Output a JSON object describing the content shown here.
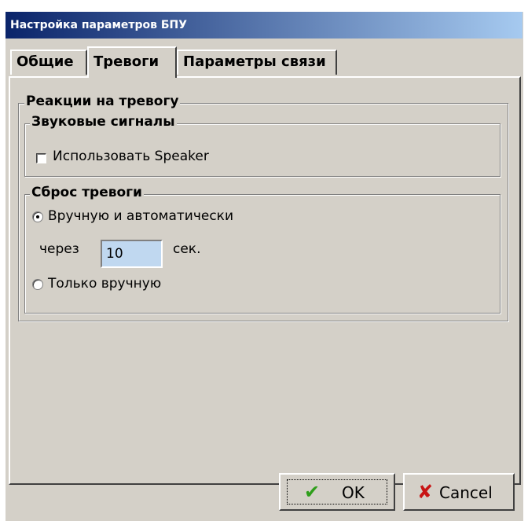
{
  "window": {
    "title": "Настройка параметров БПУ"
  },
  "tabs": [
    {
      "label": "Общие",
      "active": false
    },
    {
      "label": "Тревоги",
      "active": true
    },
    {
      "label": "Параметры связи",
      "active": false
    }
  ],
  "alarm_reactions": {
    "legend": "Реакции на тревогу",
    "sound": {
      "legend": "Звуковые сигналы",
      "use_speaker_label": "Использовать Speaker",
      "use_speaker_checked": false
    },
    "reset": {
      "legend": "Сброс тревоги",
      "manual_auto_label": "Вручную и автоматически",
      "manual_auto_selected": true,
      "after_label": "через",
      "seconds_value": "10",
      "seconds_unit": "сек.",
      "manual_only_label": "Только вручную",
      "manual_only_selected": false
    }
  },
  "buttons": {
    "ok_label": "OK",
    "cancel_label": "Cancel"
  },
  "icons": {
    "ok": "checkmark-icon",
    "cancel": "cross-icon"
  },
  "colors": {
    "title_start": "#0a246a",
    "title_end": "#a6caf0",
    "input_bg": "#c0d8f0",
    "ok_icon": "#2e9e1a",
    "cancel_icon": "#c81414"
  }
}
